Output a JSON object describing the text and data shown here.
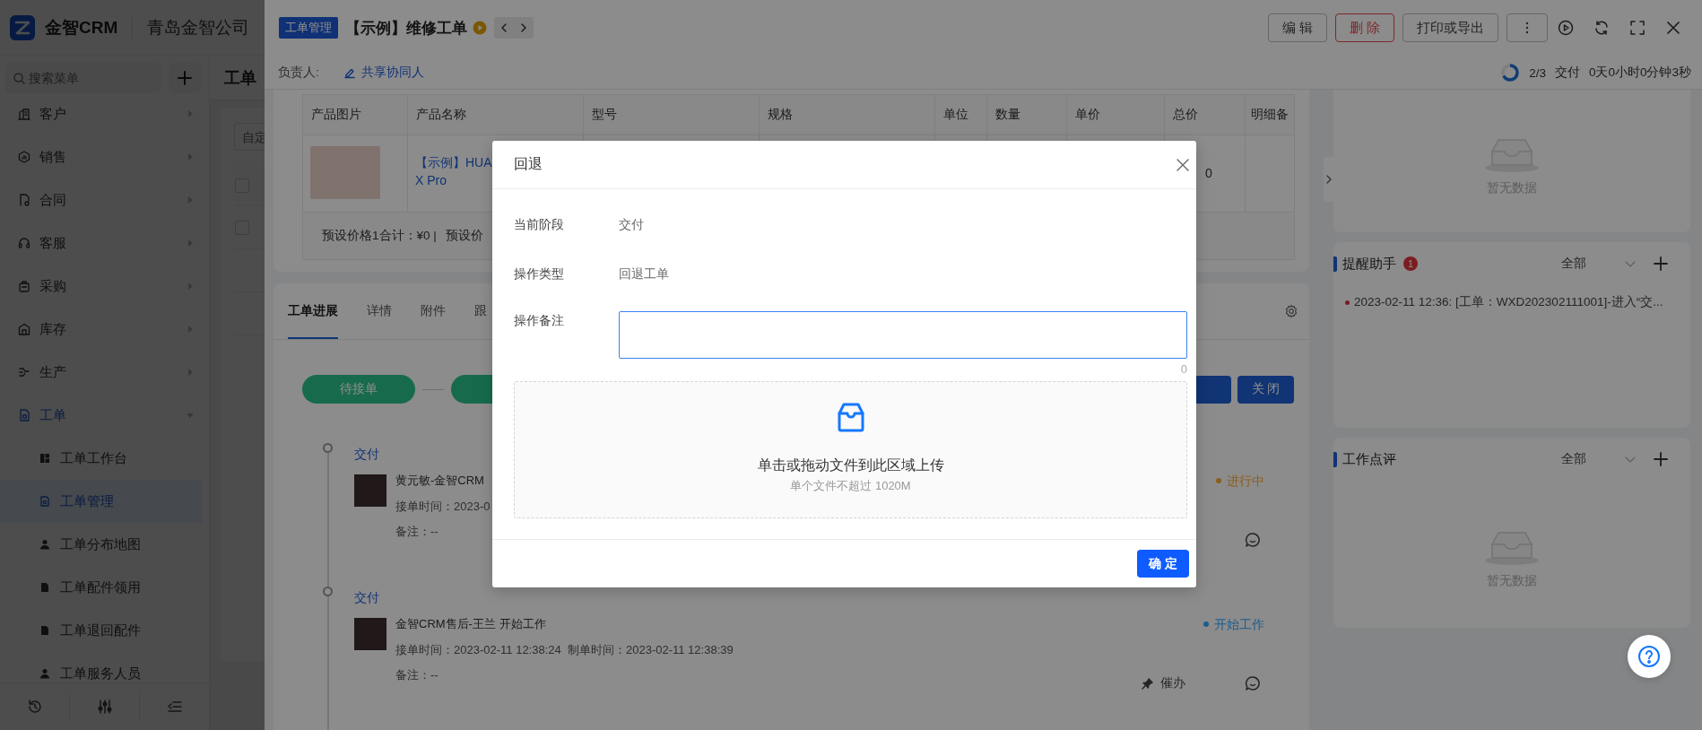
{
  "app": {
    "logo_text": "金智CRM",
    "company": "青岛金智公司"
  },
  "sidebar": {
    "search_placeholder": "搜索菜单",
    "items": [
      {
        "label": "客户",
        "expanded": false
      },
      {
        "label": "销售",
        "expanded": false
      },
      {
        "label": "合同",
        "expanded": false
      },
      {
        "label": "客服",
        "expanded": false
      },
      {
        "label": "采购",
        "expanded": false
      },
      {
        "label": "库存",
        "expanded": false
      },
      {
        "label": "生产",
        "expanded": false
      },
      {
        "label": "工单",
        "expanded": true,
        "children": [
          {
            "label": "工单工作台",
            "selected": false
          },
          {
            "label": "工单管理",
            "selected": true
          },
          {
            "label": "工单分布地图",
            "selected": false
          },
          {
            "label": "工单配件领用",
            "selected": false
          },
          {
            "label": "工单退回配件",
            "selected": false
          },
          {
            "label": "工单服务人员",
            "selected": false
          }
        ]
      }
    ]
  },
  "list_page": {
    "title": "工单",
    "filter_placeholder": "自定",
    "rows": [
      {
        "checked": false
      },
      {
        "checked": false
      }
    ]
  },
  "drawer": {
    "tag": "工单管理",
    "title": "【示例】维修工单",
    "actions": [
      {
        "label": "编 辑",
        "kind": "default"
      },
      {
        "label": "删 除",
        "kind": "danger"
      },
      {
        "label": "打印或导出",
        "kind": "default"
      }
    ],
    "owner_label": "负责人:",
    "share_link": "共享协同人",
    "progress": {
      "level": 0.67,
      "count": "2/3",
      "stage": "交付",
      "elapsed": "0天0小时0分钟3秒"
    },
    "product_table": {
      "columns": [
        "产品图片",
        "产品名称",
        "型号",
        "规格",
        "单位",
        "数量",
        "单价",
        "总价",
        "明细备"
      ],
      "rows": [
        {
          "name_lines": [
            "【示例】HUA",
            "X Pro"
          ],
          "total": "0"
        }
      ],
      "summary": [
        "预设价格1合计：¥0 |",
        "预设价"
      ]
    },
    "tabs": [
      {
        "label": "工单进展",
        "selected": true
      },
      {
        "label": "详情",
        "selected": false
      },
      {
        "label": "附件",
        "selected": false
      },
      {
        "label": "跟",
        "selected": false
      }
    ],
    "stages": [
      {
        "label": "待接单",
        "done": true
      },
      {
        "done": true
      }
    ],
    "stage_actions": [
      {
        "label": "关 闭"
      }
    ],
    "timeline": [
      {
        "stage": "交付",
        "author": "黄元敏-金智CRM",
        "time": "接单时间：2023-0",
        "note": "备注：--",
        "status": "进行中",
        "color": "#8a5e1f"
      },
      {
        "stage": "交付",
        "author": "金智CRM售后-王兰 开始工作",
        "time": "接单时间：2023-02-11 12:38:24  制单时间：2023-02-11 12:38:39",
        "note": "备注：--",
        "status": "开始工作",
        "color": "#1e5d8c",
        "urge": "催办"
      }
    ]
  },
  "side_panels": [
    {
      "kind": "empty",
      "empty_text": "暂无数据"
    },
    {
      "kind": "list",
      "title": "提醒助手",
      "badge": "1",
      "filter": "全部",
      "items": [
        "2023-02-11 12:36: [工单：WXD202302111001]-进入“交..."
      ]
    },
    {
      "kind": "empty",
      "title": "工作点评",
      "filter": "全部",
      "empty_text": "暂无数据"
    }
  ],
  "modal": {
    "title": "回退",
    "fields": [
      {
        "label": "当前阶段",
        "value": "交付"
      },
      {
        "label": "操作类型",
        "value": "回退工单"
      }
    ],
    "remark": {
      "label": "操作备注",
      "counter": "0"
    },
    "upload": {
      "text": "单击或拖动文件到此区域上传",
      "hint": "单个文件不超过 1020M"
    },
    "confirm": "确 定"
  }
}
